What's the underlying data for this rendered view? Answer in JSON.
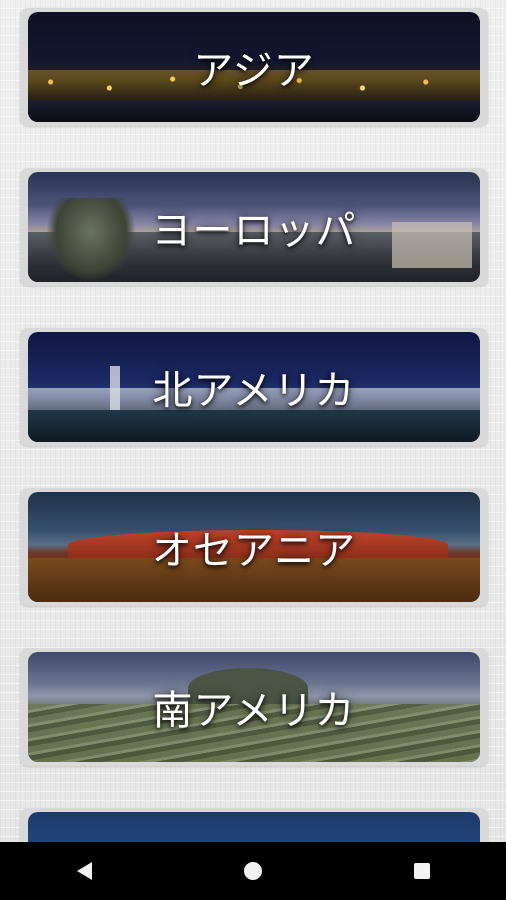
{
  "regions": [
    {
      "label": "アジア"
    },
    {
      "label": "ヨーロッパ"
    },
    {
      "label": "北アメリカ"
    },
    {
      "label": "オセアニア"
    },
    {
      "label": "南アメリカ"
    }
  ],
  "navbar": {
    "back_icon": "back-triangle-icon",
    "home_icon": "home-circle-icon",
    "recents_icon": "recents-square-icon"
  }
}
